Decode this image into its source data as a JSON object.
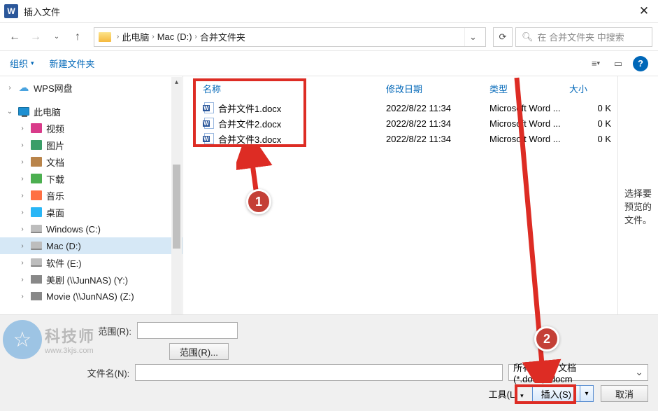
{
  "window": {
    "title": "插入文件",
    "close": "✕"
  },
  "nav": {
    "breadcrumb": [
      "此电脑",
      "Mac (D:)",
      "合并文件夹"
    ],
    "search_placeholder": "在 合并文件夹 中搜索"
  },
  "toolbar": {
    "organize": "组织",
    "new_folder": "新建文件夹",
    "help": "?"
  },
  "tree": [
    {
      "expandable": true,
      "icon": "cloud",
      "label": "WPS网盘",
      "indent": 0
    },
    {
      "divider": true
    },
    {
      "expandable": true,
      "open": true,
      "icon": "monitor",
      "label": "此电脑",
      "indent": 0
    },
    {
      "expandable": true,
      "icon": "video",
      "label": "视频",
      "indent": 1
    },
    {
      "expandable": true,
      "icon": "pict",
      "label": "图片",
      "indent": 1
    },
    {
      "expandable": true,
      "icon": "doc",
      "label": "文档",
      "indent": 1
    },
    {
      "expandable": true,
      "icon": "down",
      "label": "下载",
      "indent": 1
    },
    {
      "expandable": true,
      "icon": "music",
      "label": "音乐",
      "indent": 1
    },
    {
      "expandable": true,
      "icon": "desk",
      "label": "桌面",
      "indent": 1
    },
    {
      "expandable": true,
      "icon": "drive",
      "label": "Windows (C:)",
      "indent": 1
    },
    {
      "expandable": true,
      "icon": "drive",
      "label": "Mac (D:)",
      "indent": 1,
      "selected": true
    },
    {
      "expandable": true,
      "icon": "drive",
      "label": "软件 (E:)",
      "indent": 1
    },
    {
      "expandable": true,
      "icon": "net",
      "label": "美剧 (\\\\JunNAS) (Y:)",
      "indent": 1
    },
    {
      "expandable": true,
      "icon": "net",
      "label": "Movie (\\\\JunNAS) (Z:)",
      "indent": 1
    }
  ],
  "columns": {
    "name": "名称",
    "date": "修改日期",
    "type": "类型",
    "size": "大小"
  },
  "files": [
    {
      "name": "合并文件1.docx",
      "date": "2022/8/22 11:34",
      "type": "Microsoft Word ...",
      "size": "0 K"
    },
    {
      "name": "合并文件2.docx",
      "date": "2022/8/22 11:34",
      "type": "Microsoft Word ...",
      "size": "0 K"
    },
    {
      "name": "合并文件3.docx",
      "date": "2022/8/22 11:34",
      "type": "Microsoft Word ...",
      "size": "0 K"
    }
  ],
  "preview_msg": "选择要预览的文件。",
  "bottom": {
    "range_label": "范围(R):",
    "range_button": "范围(R)...",
    "filename_label": "文件名(N):",
    "filename_value": "",
    "filter": "所有 Word 文档(*.docx;*.docm",
    "tools": "工具(L)",
    "insert": "插入(S)",
    "cancel": "取消"
  },
  "watermark": {
    "big": "科技师",
    "small": "www.3kjs.com"
  },
  "annotations": {
    "badge1": "1",
    "badge2": "2"
  }
}
